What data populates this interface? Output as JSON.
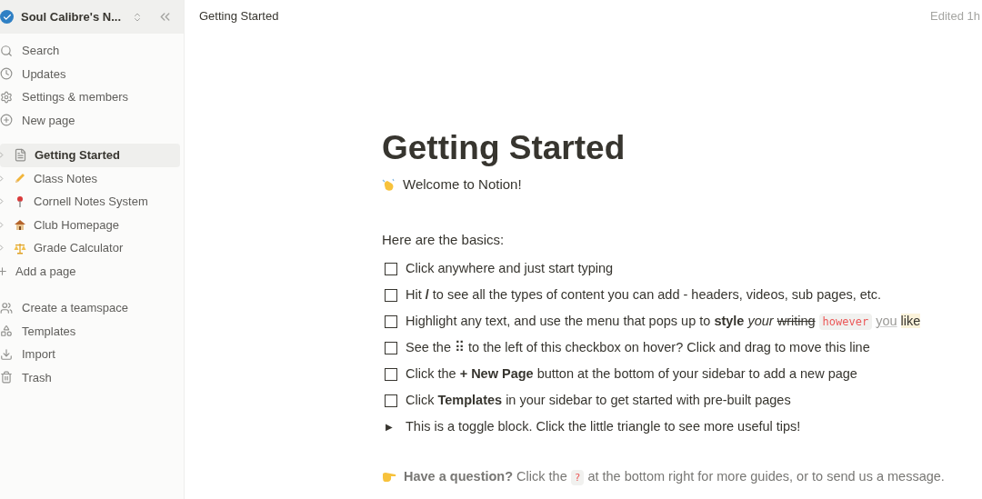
{
  "sidebar": {
    "workspace": "Soul Calibre's N...",
    "actions": [
      {
        "kind": "search",
        "label": "Search"
      },
      {
        "kind": "updates",
        "label": "Updates"
      },
      {
        "kind": "settings",
        "label": "Settings & members"
      },
      {
        "kind": "new",
        "label": "New page"
      }
    ],
    "pages": [
      {
        "kind": "doc",
        "label": "Getting Started",
        "selected": true
      },
      {
        "kind": "pencil",
        "label": "Class Notes",
        "selected": false
      },
      {
        "kind": "pin",
        "label": "Cornell Notes System",
        "selected": false
      },
      {
        "kind": "house",
        "label": "Club Homepage",
        "selected": false
      },
      {
        "kind": "scale",
        "label": "Grade Calculator",
        "selected": false
      }
    ],
    "add_page": "Add a page",
    "footer": [
      {
        "kind": "teamspace",
        "label": "Create a teamspace"
      },
      {
        "kind": "templates",
        "label": "Templates"
      },
      {
        "kind": "import",
        "label": "Import"
      },
      {
        "kind": "trash",
        "label": "Trash"
      }
    ]
  },
  "topbar": {
    "breadcrumb": "Getting Started",
    "edited": "Edited 1h"
  },
  "page": {
    "title": "Getting Started",
    "welcome": "Welcome to Notion!",
    "intro": "Here are the basics:",
    "todos": [
      {
        "checked": false,
        "segments": [
          {
            "kind": "plain",
            "text": "Click anywhere and just start typing"
          }
        ]
      },
      {
        "checked": false,
        "segments": [
          {
            "kind": "plain",
            "text": "Hit "
          },
          {
            "kind": "bold",
            "text": "/"
          },
          {
            "kind": "plain",
            "text": " to see all the types of content you can add - headers, videos, sub pages, etc."
          }
        ]
      },
      {
        "checked": false,
        "segments": [
          {
            "kind": "plain",
            "text": "Highlight any text, and use the menu that pops up to "
          },
          {
            "kind": "bold",
            "text": "style"
          },
          {
            "kind": "italic",
            "text": "your"
          },
          {
            "kind": "strike",
            "text": "writing"
          },
          {
            "kind": "code",
            "text": "however"
          },
          {
            "kind": "underline",
            "text": "you"
          },
          {
            "kind": "highlight",
            "text": "like"
          }
        ]
      },
      {
        "checked": false,
        "segments": [
          {
            "kind": "plain",
            "text": "See the ⠿ to the left of this checkbox on hover? Click and drag to move this line"
          }
        ]
      },
      {
        "checked": false,
        "segments": [
          {
            "kind": "plain",
            "text": "Click the "
          },
          {
            "kind": "bold",
            "text": "+ New Page"
          },
          {
            "kind": "plain",
            "text": " button at the bottom of your sidebar to add a new page"
          }
        ]
      },
      {
        "checked": false,
        "segments": [
          {
            "kind": "plain",
            "text": "Click "
          },
          {
            "kind": "bold",
            "text": "Templates"
          },
          {
            "kind": "plain",
            "text": " in your sidebar to get started with pre-built pages"
          }
        ]
      }
    ],
    "toggle": {
      "arrow": "▶",
      "text": "This is a toggle block. Click the little triangle to see more useful tips!",
      "expanded": false
    },
    "question": {
      "bold": "Have a question?",
      "before": "Click the",
      "code": "?",
      "after": "at the bottom right for more guides, or to send us a message."
    }
  }
}
